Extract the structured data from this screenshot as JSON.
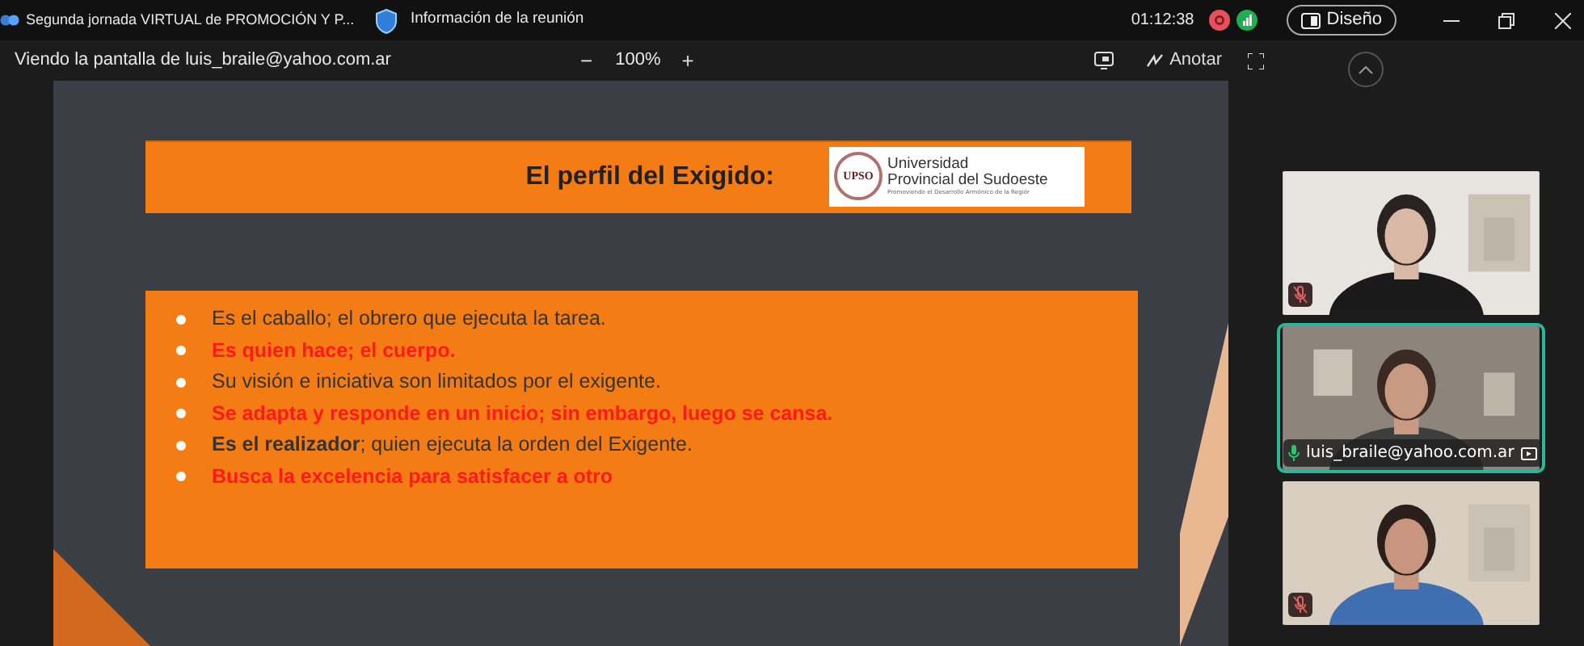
{
  "window": {
    "title": "Segunda jornada VIRTUAL de PROMOCIÓN Y P...",
    "meeting_info": "Información de la reunión",
    "timer": "01:12:38",
    "recording": true,
    "layout_button": "Diseño"
  },
  "toolbar": {
    "viewing": "Viendo la pantalla de luis_braile@yahoo.com.ar",
    "zoom_out": "−",
    "zoom": "100%",
    "zoom_in": "+",
    "annotate": "Anotar"
  },
  "slide": {
    "title": "El perfil del Exigido:",
    "logo": {
      "emblem": "UPSO",
      "line_1": "Universidad",
      "line_2": "Provincial del Sudoeste",
      "tagline": "Promoviendo el Desarrollo Armónico de la Regiór"
    },
    "bullets": [
      {
        "text": "Es el caballo; el obrero que ejecuta la tarea.",
        "emphasis": false
      },
      {
        "text": "Es quien hace; el cuerpo.",
        "emphasis": true
      },
      {
        "text": "Su visión e iniciativa son limitados por el exigente.",
        "emphasis": false
      },
      {
        "text": "Se adapta y responde en un inicio; sin embargo, luego se cansa.",
        "emphasis": true
      },
      {
        "text": "**Es el realizador**; quien ejecuta la orden del Exigente.",
        "emphasis": false
      },
      {
        "text": "Busca la excelencia para satisfacer a otro",
        "emphasis": true
      }
    ]
  },
  "participants": [
    {
      "kind": "picture",
      "muted": true,
      "speaking": false
    },
    {
      "kind": "picture",
      "name": "luis_braile@yahoo.com.ar",
      "muted": false,
      "speaking": true
    },
    {
      "kind": "picture",
      "muted": true,
      "speaking": false
    }
  ]
}
